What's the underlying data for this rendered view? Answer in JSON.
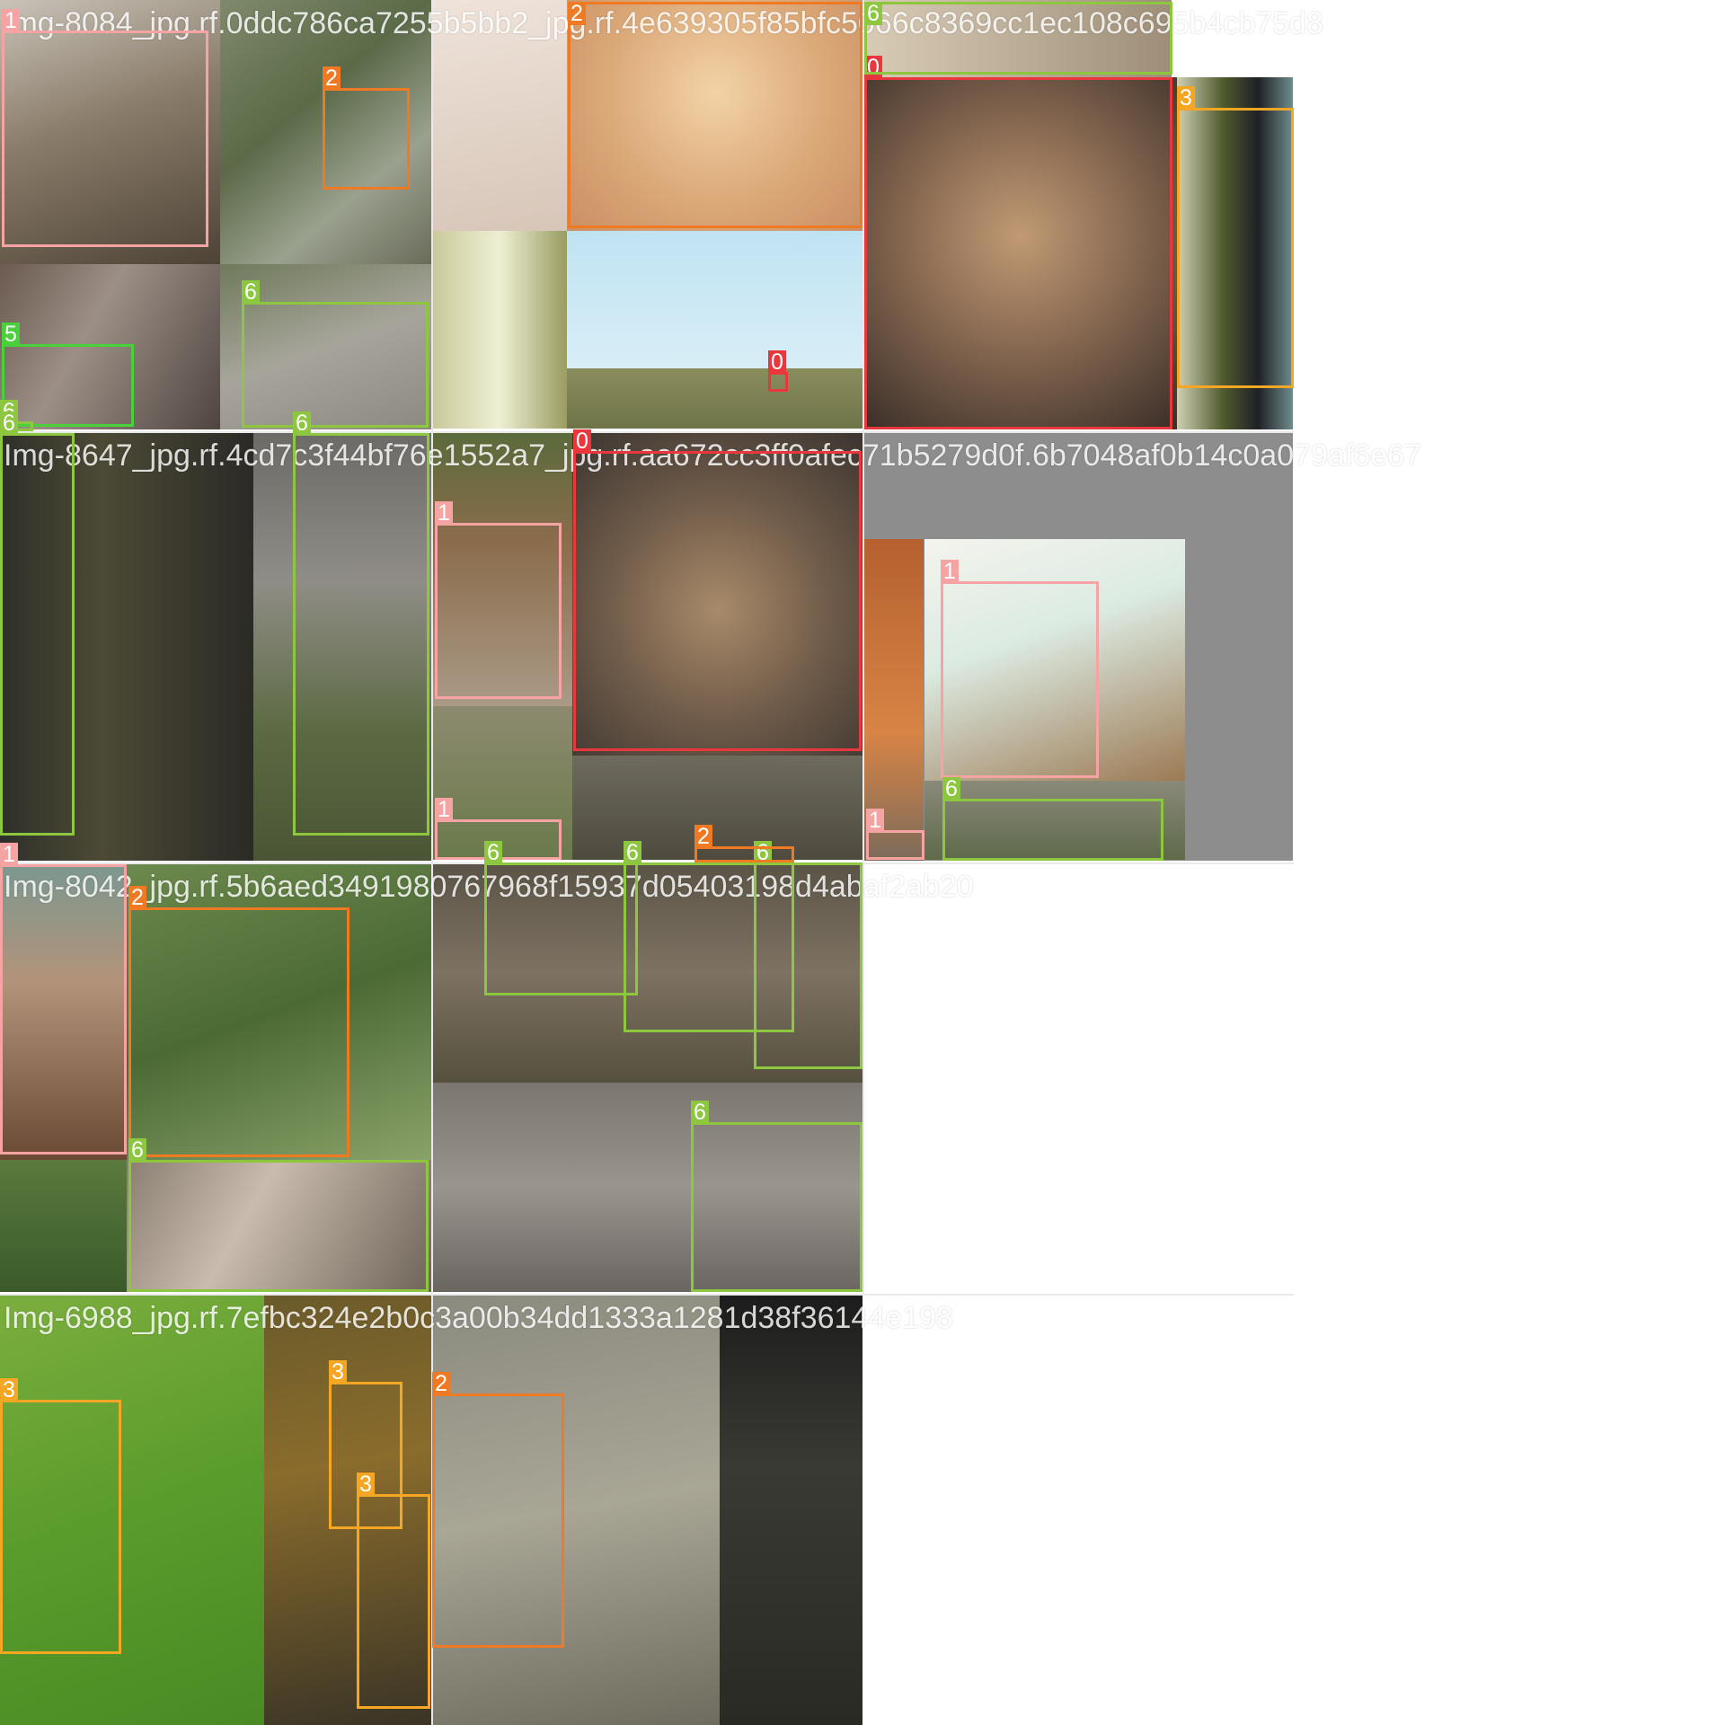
{
  "mosaic": {
    "captions": [
      "Img-8084_jpg.rf.0ddc786ca7255b5bb2_jpg.rf.4e639305f85bfc5066c8369cc1ec108c695b4cb75d8",
      "Img-8647_jpg.rf.4cd7c3f44bf76e1552a7_jpg.rf.aa672cc3ff0afec71b5279d0f.6b7048af0b14c0a079af6e67",
      "Img-8042_jpg.rf.5b6aed3491980767968f15937d05403198d4abaf2ab20",
      "Img-6988_jpg.rf.7efbc324e2b0c3a00b34dd1333a1281d38f36144e198"
    ],
    "class_colors": {
      "0": "#e8383d",
      "1": "#f5a3a3",
      "2": "#f07a23",
      "3": "#f5a623",
      "5": "#4ad03a",
      "6": "#8dc63f"
    },
    "detections": [
      {
        "label": "1"
      },
      {
        "label": "2"
      },
      {
        "label": "5"
      },
      {
        "label": "6"
      },
      {
        "label": "6"
      },
      {
        "label": "2"
      },
      {
        "label": "0"
      },
      {
        "label": "6"
      },
      {
        "label": "0"
      },
      {
        "label": "3"
      },
      {
        "label": "6"
      },
      {
        "label": "6"
      },
      {
        "label": "1"
      },
      {
        "label": "1"
      },
      {
        "label": "0"
      },
      {
        "label": "1"
      },
      {
        "label": "6"
      },
      {
        "label": "1"
      },
      {
        "label": "6"
      },
      {
        "label": "6"
      },
      {
        "label": "6"
      },
      {
        "label": "2"
      },
      {
        "label": "1"
      },
      {
        "label": "2"
      },
      {
        "label": "6"
      },
      {
        "label": "6"
      },
      {
        "label": "3"
      },
      {
        "label": "3"
      },
      {
        "label": "3"
      },
      {
        "label": "2"
      }
    ]
  }
}
